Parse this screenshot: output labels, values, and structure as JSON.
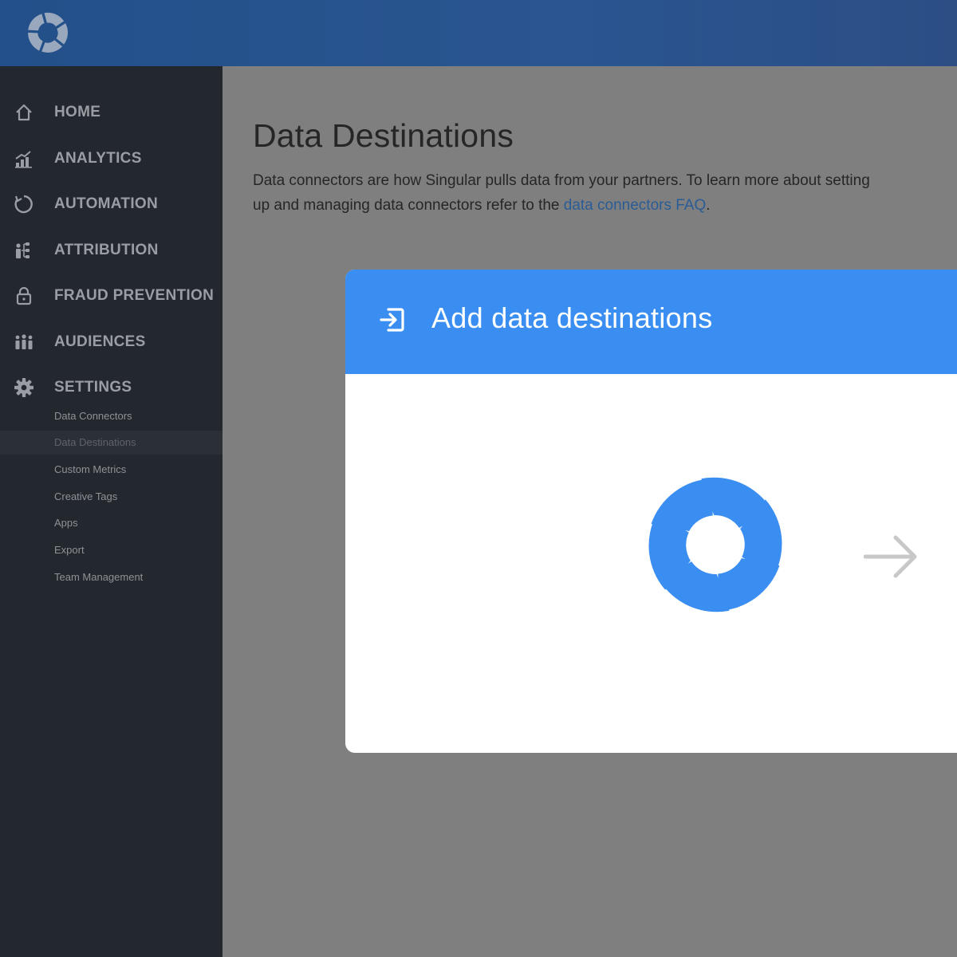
{
  "app": {
    "logo_icon": "singular-logo-icon"
  },
  "sidebar": {
    "items": [
      {
        "label": "HOME",
        "icon": "home-icon"
      },
      {
        "label": "ANALYTICS",
        "icon": "analytics-icon"
      },
      {
        "label": "AUTOMATION",
        "icon": "automation-icon"
      },
      {
        "label": "ATTRIBUTION",
        "icon": "attribution-icon"
      },
      {
        "label": "FRAUD PREVENTION",
        "icon": "lock-icon"
      },
      {
        "label": "AUDIENCES",
        "icon": "audiences-icon"
      },
      {
        "label": "SETTINGS",
        "icon": "gear-icon"
      }
    ],
    "settings_subitems": [
      {
        "label": "Data Connectors",
        "active": false
      },
      {
        "label": "Data Destinations",
        "active": true
      },
      {
        "label": "Custom Metrics",
        "active": false
      },
      {
        "label": "Creative Tags",
        "active": false
      },
      {
        "label": "Apps",
        "active": false
      },
      {
        "label": "Export",
        "active": false
      },
      {
        "label": "Team Management",
        "active": false
      }
    ]
  },
  "main": {
    "title": "Data Destinations",
    "intro_text": "Data connectors are how Singular pulls data from your partners. To learn more about setting up and managing data connectors refer to the",
    "intro_link": "data connectors FAQ",
    "intro_end": "."
  },
  "card": {
    "title": "Add data destinations",
    "header_icon": "import-icon",
    "logo_icon": "singular-logo-icon",
    "arrow_icon": "arrow-right-icon"
  },
  "colors": {
    "topbar": "#2a5590",
    "sidebar": "#23272e",
    "overlay": "#7f7f7f",
    "accent": "#3a8ef2",
    "link": "#2a5c96"
  }
}
